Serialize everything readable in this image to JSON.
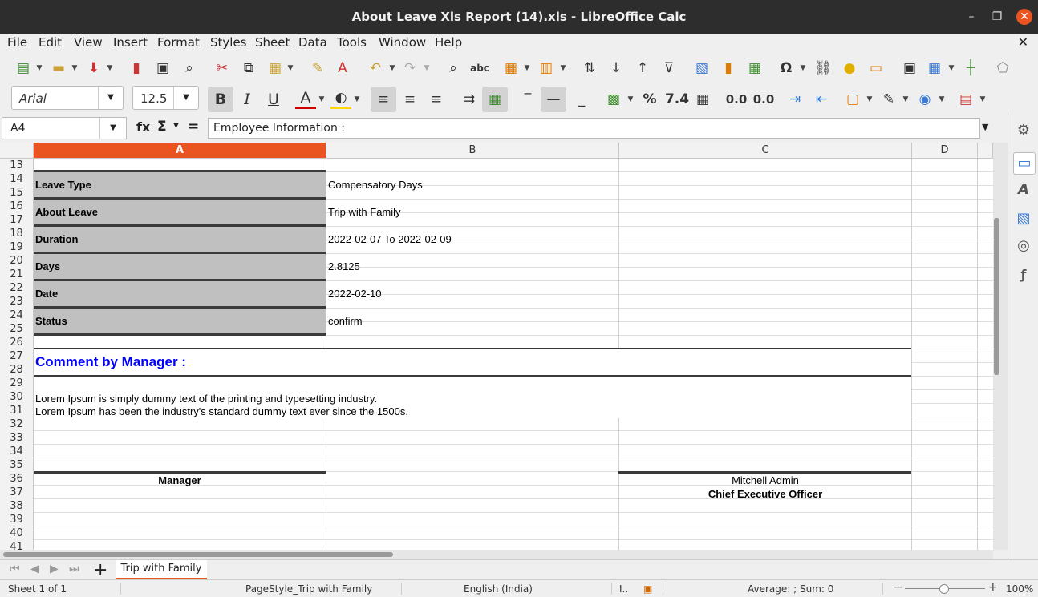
{
  "window": {
    "title": "About Leave Xls Report (14).xls - LibreOffice Calc",
    "minimize_glyph": "–",
    "restore_glyph": "❐",
    "close_glyph": "✕"
  },
  "menu": [
    "File",
    "Edit",
    "View",
    "Insert",
    "Format",
    "Styles",
    "Sheet",
    "Data",
    "Tools",
    "Window",
    "Help"
  ],
  "doc_close_glyph": "✕",
  "format_toolbar": {
    "font_name": "Arial",
    "font_size": "12.5",
    "bold": "B",
    "italic": "I",
    "underline": "U",
    "percent": "%",
    "number": "7.4",
    "add_decimal": "0.0",
    "del_decimal": "0.0"
  },
  "formula_bar": {
    "cell_ref": "A4",
    "fx": "fx",
    "sigma": "Σ",
    "equals": "=",
    "content": "Employee Information :"
  },
  "columns": [
    "A",
    "B",
    "C",
    "D"
  ],
  "rows": [
    "13",
    "14",
    "15",
    "16",
    "17",
    "18",
    "19",
    "20",
    "21",
    "22",
    "23",
    "24",
    "25",
    "26",
    "27",
    "28",
    "29",
    "30",
    "31",
    "32",
    "33",
    "34",
    "35",
    "36",
    "37",
    "38",
    "39",
    "40",
    "41"
  ],
  "leave": {
    "type_label": "Leave Type",
    "type_value": "Compensatory Days",
    "about_label": "About Leave",
    "about_value": "Trip with Family",
    "duration_label": "Duration",
    "duration_value": "2022-02-07 To 2022-02-09",
    "days_label": "Days",
    "days_value": "2.8125",
    "date_label": "Date",
    "date_value": "2022-02-10",
    "status_label": "Status",
    "status_value": "confirm"
  },
  "comment": {
    "heading": "Comment by Manager :",
    "line1": "Lorem Ipsum is simply dummy text of the printing and typesetting industry.",
    "line2": "Lorem Ipsum has been the industry's standard dummy text ever since the 1500s."
  },
  "signatures": {
    "manager_label": "Manager",
    "ceo_name": "Mitchell Admin",
    "ceo_title": "Chief Executive Officer"
  },
  "tabs": {
    "add_glyph": "+",
    "sheet_name": "Trip with Family"
  },
  "status": {
    "sheet": "Sheet 1 of 1",
    "page_style": "PageStyle_Trip with Family",
    "language": "English (India)",
    "summary": "Average: ; Sum: 0",
    "zoom_minus": "−",
    "zoom_plus": "+",
    "zoom": "100%"
  },
  "colors": {
    "accent": "#e95420",
    "label_fill": "#c0c0c0",
    "comment_heading": "#0000ff",
    "titlebar": "#2d2d2d"
  }
}
